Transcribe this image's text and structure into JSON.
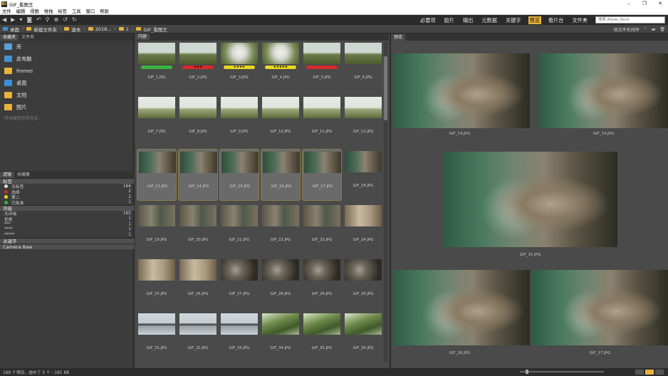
{
  "window": {
    "title": "GIF_看图王"
  },
  "menu": [
    "文件",
    "编辑",
    "视图",
    "堆栈",
    "标签",
    "工具",
    "窗口",
    "帮助"
  ],
  "workspaces": [
    {
      "label": "必要项",
      "active": false
    },
    {
      "label": "胶片",
      "active": false
    },
    {
      "label": "输出",
      "active": false
    },
    {
      "label": "元数据",
      "active": false
    },
    {
      "label": "关键字",
      "active": false
    },
    {
      "label": "预览",
      "active": true
    },
    {
      "label": "看片台",
      "active": false
    },
    {
      "label": "文件夹",
      "active": false
    }
  ],
  "search": {
    "placeholder": "搜索 Adobe Stock"
  },
  "breadcrumb": [
    "桌面",
    "新建文件夹",
    "速本",
    "2018...",
    "1",
    "GIF_看图王"
  ],
  "sort_label": "按文件名排序",
  "left_panel": {
    "tabs": [
      "收藏夹",
      "文件夹"
    ],
    "favorites": [
      {
        "label": "库",
        "icon": "library-icon",
        "color": "#5aa0d8"
      },
      {
        "label": "此电脑",
        "icon": "computer-icon",
        "color": "#4a90d0"
      },
      {
        "label": "fmmei",
        "icon": "user-folder-icon",
        "color": "#e8b23c"
      },
      {
        "label": "桌面",
        "icon": "desktop-icon",
        "color": "#3a8fd8"
      },
      {
        "label": "文档",
        "icon": "documents-icon",
        "color": "#e8b23c"
      },
      {
        "label": "图片",
        "icon": "pictures-icon",
        "color": "#e8b23c"
      }
    ],
    "fav_hint": "将收藏夹拖移至此..."
  },
  "filter_panel": {
    "tabs": [
      "滤镜",
      "收藏集"
    ],
    "label_section": "标签",
    "labels": [
      {
        "name": "无标签",
        "count": "164",
        "color": "#dddddd"
      },
      {
        "name": "选择",
        "count": "2",
        "color": "#d42a2a"
      },
      {
        "name": "第二",
        "count": "2",
        "color": "#e8d81c"
      },
      {
        "name": "已批准",
        "count": "1",
        "color": "#3cb43c"
      }
    ],
    "rating_section": "评级",
    "ratings": [
      {
        "name": "无评级",
        "count": "165"
      },
      {
        "name": "拒绝",
        "count": "1"
      },
      {
        "name": "***",
        "count": "1"
      },
      {
        "name": "****",
        "count": "1"
      },
      {
        "name": "*****",
        "count": "1"
      }
    ],
    "keyword_section": "关键字",
    "camera_section": "Camera Raw"
  },
  "content_tab": "内容",
  "preview_tab": "预览",
  "thumbnails": [
    {
      "name": "GIF_1.JPG",
      "stars": "",
      "label_color": "#3cb43c",
      "selected": false,
      "palette": "field"
    },
    {
      "name": "GIF_2.JPG",
      "stars": "★★★",
      "label_color": "#d42a2a",
      "selected": false,
      "palette": "field"
    },
    {
      "name": "GIF_3.JPG",
      "stars": "★★★★",
      "label_color": "#e8d81c",
      "selected": false,
      "palette": "smoke"
    },
    {
      "name": "GIF_4.JPG",
      "stars": "★★★★★",
      "label_color": "#e8d81c",
      "selected": false,
      "palette": "smoke"
    },
    {
      "name": "GIF_5.JPG",
      "stars": "",
      "label_color": "#d42a2a",
      "selected": false,
      "palette": "field"
    },
    {
      "name": "GIF_6.JPG",
      "stars": "",
      "label_color": "",
      "selected": false,
      "palette": "field"
    },
    {
      "name": "GIF_7.JPG",
      "stars": "",
      "label_color": "",
      "selected": false,
      "palette": "sky"
    },
    {
      "name": "GIF_8.JPG",
      "stars": "",
      "label_color": "",
      "selected": false,
      "palette": "sky"
    },
    {
      "name": "GIF_9.JPG",
      "stars": "",
      "label_color": "",
      "selected": false,
      "palette": "sky"
    },
    {
      "name": "GIF_10.JPG",
      "stars": "",
      "label_color": "",
      "selected": false,
      "palette": "sky"
    },
    {
      "name": "GIF_11.JPG",
      "stars": "",
      "label_color": "",
      "selected": false,
      "palette": "sky"
    },
    {
      "name": "GIF_12.JPG",
      "stars": "",
      "label_color": "",
      "selected": false,
      "palette": "sky"
    },
    {
      "name": "GIF_13.JPG",
      "stars": "",
      "label_color": "",
      "selected": true,
      "palette": "soldier"
    },
    {
      "name": "GIF_14.JPG",
      "stars": "",
      "label_color": "",
      "selected": true,
      "palette": "soldier"
    },
    {
      "name": "GIF_15.JPG",
      "stars": "",
      "label_color": "",
      "selected": true,
      "palette": "soldier"
    },
    {
      "name": "GIF_16.JPG",
      "stars": "",
      "label_color": "",
      "selected": true,
      "palette": "soldier"
    },
    {
      "name": "GIF_17.JPG",
      "stars": "",
      "label_color": "",
      "selected": true,
      "palette": "soldier"
    },
    {
      "name": "GIF_18.JPG",
      "stars": "",
      "label_color": "",
      "selected": false,
      "palette": "soldier"
    },
    {
      "name": "GIF_19.JPG",
      "stars": "",
      "label_color": "",
      "selected": false,
      "palette": "wall"
    },
    {
      "name": "GIF_20.JPG",
      "stars": "",
      "label_color": "",
      "selected": false,
      "palette": "wall"
    },
    {
      "name": "GIF_21.JPG",
      "stars": "",
      "label_color": "",
      "selected": false,
      "palette": "wall"
    },
    {
      "name": "GIF_22.JPG",
      "stars": "",
      "label_color": "",
      "selected": false,
      "palette": "wall"
    },
    {
      "name": "GIF_23.JPG",
      "stars": "",
      "label_color": "",
      "selected": false,
      "palette": "wall"
    },
    {
      "name": "GIF_24.JPG",
      "stars": "",
      "label_color": "",
      "selected": false,
      "palette": "blur"
    },
    {
      "name": "GIF_25.JPG",
      "stars": "",
      "label_color": "",
      "selected": false,
      "palette": "blur"
    },
    {
      "name": "GIF_26.JPG",
      "stars": "",
      "label_color": "",
      "selected": false,
      "palette": "blur"
    },
    {
      "name": "GIF_27.JPG",
      "stars": "",
      "label_color": "",
      "selected": false,
      "palette": "dark"
    },
    {
      "name": "GIF_28.JPG",
      "stars": "",
      "label_color": "",
      "selected": false,
      "palette": "dark"
    },
    {
      "name": "GIF_29.JPG",
      "stars": "",
      "label_color": "",
      "selected": false,
      "palette": "dark"
    },
    {
      "name": "GIF_30.JPG",
      "stars": "",
      "label_color": "",
      "selected": false,
      "palette": "dark"
    },
    {
      "name": "GIF_31.JPG",
      "stars": "",
      "label_color": "",
      "selected": false,
      "palette": "gun"
    },
    {
      "name": "GIF_32.JPG",
      "stars": "",
      "label_color": "",
      "selected": false,
      "palette": "gun"
    },
    {
      "name": "GIF_33.JPG",
      "stars": "",
      "label_color": "",
      "selected": false,
      "palette": "gun"
    },
    {
      "name": "GIF_34.JPG",
      "stars": "",
      "label_color": "",
      "selected": false,
      "palette": "grass"
    },
    {
      "name": "GIF_35.JPG",
      "stars": "",
      "label_color": "",
      "selected": false,
      "palette": "grass"
    },
    {
      "name": "GIF_36.JPG",
      "stars": "",
      "label_color": "",
      "selected": false,
      "palette": "grass"
    }
  ],
  "preview": {
    "images": [
      {
        "name": "GIF_13.JPG"
      },
      {
        "name": "GIF_14.JPG"
      },
      {
        "name": "GIF_15.JPG"
      },
      {
        "name": "GIF_16.JPG"
      },
      {
        "name": "GIF_17.JPG"
      }
    ]
  },
  "status": {
    "text": "169 个项目，选中了 5 个 - 181 KB"
  },
  "colors": {
    "accent": "#e8b23c",
    "panel": "#4a4a4a",
    "dark": "#2a2a2a"
  }
}
